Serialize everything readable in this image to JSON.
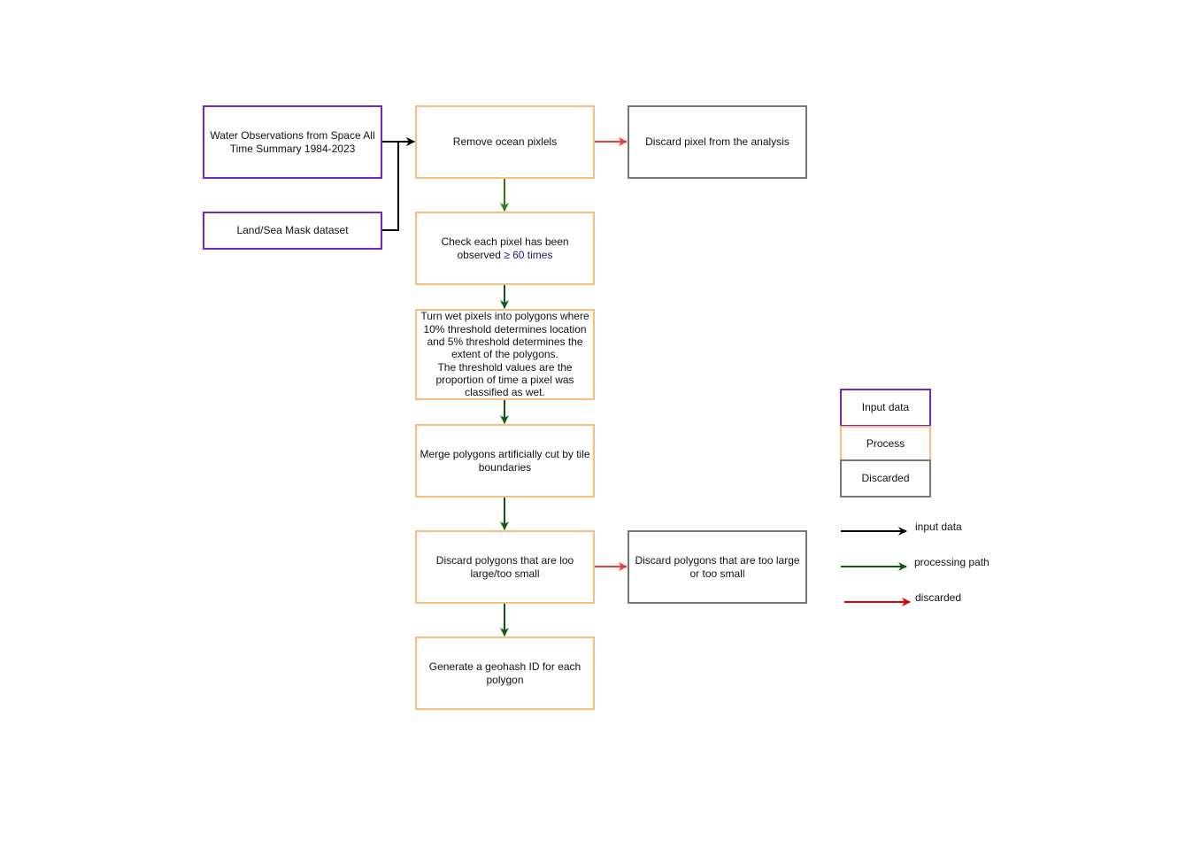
{
  "colors": {
    "input": "#7324c4",
    "process": "#f7bd7d",
    "discarded": "#777777",
    "input_arrow": "#000000",
    "processing_arrow": "#0d5c0d",
    "discarded_arrow": "#f03c3c"
  },
  "nodes": {
    "wofs": "Water Observations from Space All Time Summary 1984-2023",
    "landsea": "Land/Sea Mask dataset",
    "remove_ocean": "Remove ocean pixlels",
    "discard_pixel": "Discard pixel from the analysis",
    "check_pixel_prefix": "Check each pixel has been observed ",
    "check_pixel_highlight": "≥ 60 times",
    "turn_wet_1": "Turn wet pixels into polygons where 10% threshold determines location and 5% threshold determines the extent of the polygons.",
    "turn_wet_2": "The threshold values are the proportion of time a pixel was classified as wet.",
    "merge": "Merge polygons artificially cut by tile boundaries",
    "discard_size": "Discard polygons that are loo large/too small",
    "discard_polygons": "Discard polygons that are too large or too small",
    "geohash": "Generate a geohash ID for each polygon"
  },
  "legend": {
    "boxes": [
      "Input data",
      "Process",
      "Discarded"
    ],
    "arrows": [
      "input data",
      "processing path",
      "discarded"
    ]
  }
}
